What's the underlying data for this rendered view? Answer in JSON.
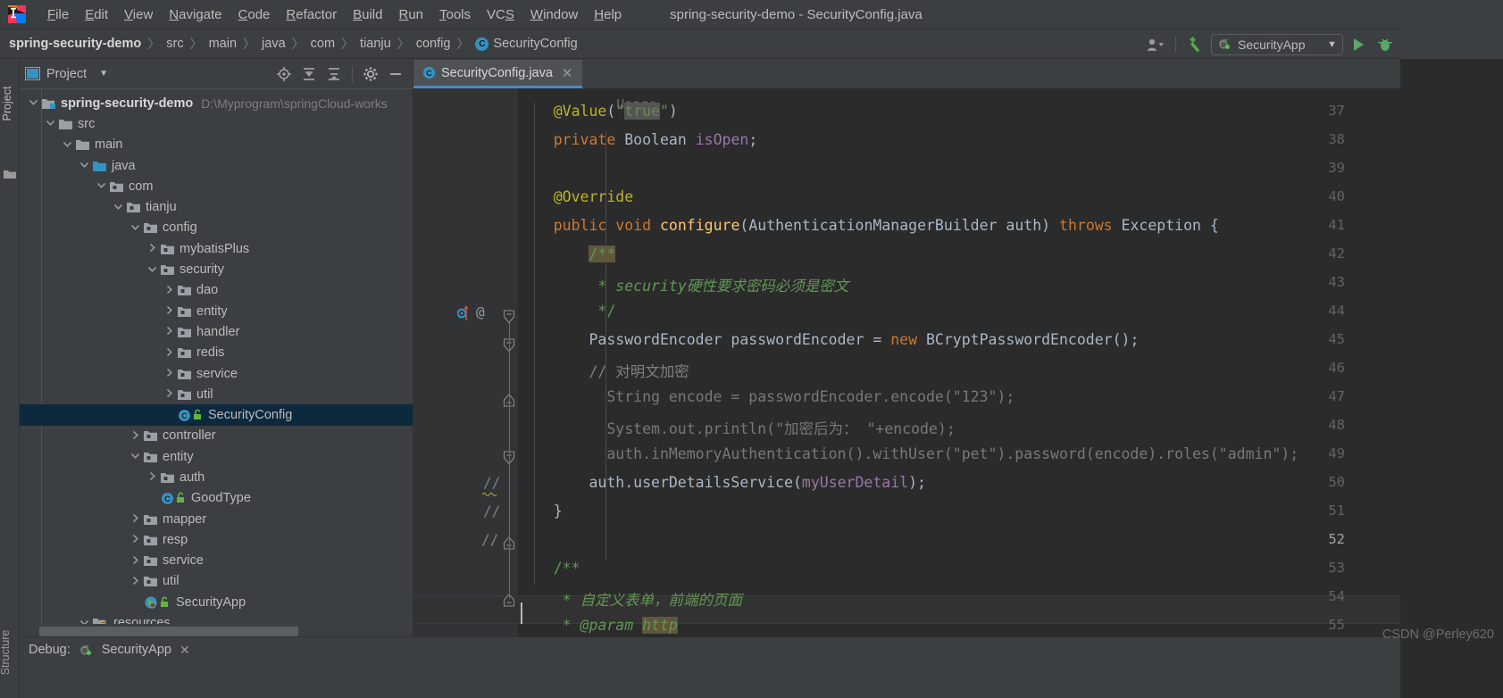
{
  "window": {
    "title": "spring-security-demo - SecurityConfig.java"
  },
  "menubar": {
    "items": [
      {
        "label": "File",
        "mnemonic": "F"
      },
      {
        "label": "Edit",
        "mnemonic": "E"
      },
      {
        "label": "View",
        "mnemonic": "V"
      },
      {
        "label": "Navigate",
        "mnemonic": "N"
      },
      {
        "label": "Code",
        "mnemonic": "C"
      },
      {
        "label": "Refactor",
        "mnemonic": "R"
      },
      {
        "label": "Build",
        "mnemonic": "B"
      },
      {
        "label": "Run",
        "mnemonic": "R"
      },
      {
        "label": "Tools",
        "mnemonic": "T"
      },
      {
        "label": "VCS",
        "mnemonic": "S"
      },
      {
        "label": "Window",
        "mnemonic": "W"
      },
      {
        "label": "Help",
        "mnemonic": "H"
      }
    ]
  },
  "breadcrumb": {
    "items": [
      "spring-security-demo",
      "src",
      "main",
      "java",
      "com",
      "tianju",
      "config",
      "SecurityConfig"
    ],
    "class_badge": "C",
    "separator": "〉"
  },
  "toolbar": {
    "run_config": "SecurityApp",
    "icons": [
      "user-icon",
      "hammer-icon",
      "run-icon",
      "debug-icon"
    ]
  },
  "left_strip": {
    "project_tab": "Project",
    "structure_tab": "Structure"
  },
  "project_panel": {
    "title": "Project",
    "header_icons": [
      "locate-icon",
      "expand-all-icon",
      "collapse-all-icon",
      "settings-icon",
      "hide-icon"
    ],
    "tree": [
      {
        "label": "spring-security-demo",
        "path": "D:\\Myprogram\\springCloud-works",
        "depth": 0,
        "state": "open",
        "icon": "module-folder",
        "bold": true
      },
      {
        "label": "src",
        "depth": 1,
        "state": "open",
        "icon": "folder"
      },
      {
        "label": "main",
        "depth": 2,
        "state": "open",
        "icon": "folder"
      },
      {
        "label": "java",
        "depth": 3,
        "state": "open",
        "icon": "source-folder"
      },
      {
        "label": "com",
        "depth": 4,
        "state": "open",
        "icon": "package"
      },
      {
        "label": "tianju",
        "depth": 5,
        "state": "open",
        "icon": "package"
      },
      {
        "label": "config",
        "depth": 6,
        "state": "open",
        "icon": "package"
      },
      {
        "label": "mybatisPlus",
        "depth": 7,
        "state": "closed",
        "icon": "package"
      },
      {
        "label": "security",
        "depth": 7,
        "state": "open",
        "icon": "package"
      },
      {
        "label": "dao",
        "depth": 8,
        "state": "closed",
        "icon": "package"
      },
      {
        "label": "entity",
        "depth": 8,
        "state": "closed",
        "icon": "package"
      },
      {
        "label": "handler",
        "depth": 8,
        "state": "closed",
        "icon": "package"
      },
      {
        "label": "redis",
        "depth": 8,
        "state": "closed",
        "icon": "package"
      },
      {
        "label": "service",
        "depth": 8,
        "state": "closed",
        "icon": "package"
      },
      {
        "label": "util",
        "depth": 8,
        "state": "closed",
        "icon": "package"
      },
      {
        "label": "SecurityConfig",
        "depth": 8,
        "state": "leaf",
        "icon": "java-class",
        "selected": true
      },
      {
        "label": "controller",
        "depth": 6,
        "state": "closed",
        "icon": "package"
      },
      {
        "label": "entity",
        "depth": 6,
        "state": "open",
        "icon": "package"
      },
      {
        "label": "auth",
        "depth": 7,
        "state": "closed",
        "icon": "package"
      },
      {
        "label": "GoodType",
        "depth": 7,
        "state": "leaf",
        "icon": "java-class"
      },
      {
        "label": "mapper",
        "depth": 6,
        "state": "closed",
        "icon": "package"
      },
      {
        "label": "resp",
        "depth": 6,
        "state": "closed",
        "icon": "package"
      },
      {
        "label": "service",
        "depth": 6,
        "state": "closed",
        "icon": "package"
      },
      {
        "label": "util",
        "depth": 6,
        "state": "closed",
        "icon": "package"
      },
      {
        "label": "SecurityApp",
        "depth": 6,
        "state": "leaf",
        "icon": "spring-class"
      },
      {
        "label": "resources",
        "depth": 3,
        "state": "open",
        "icon": "resource-folder"
      }
    ]
  },
  "editor": {
    "tab": {
      "label": "SecurityConfig.java",
      "close": "✕",
      "icon": "java-class"
    },
    "usage_hint": "Usage",
    "line_numbers": [
      "37",
      "38",
      "39",
      "40",
      "41",
      "42",
      "43",
      "44",
      "45",
      "46",
      "47",
      "48",
      "49",
      "50",
      "51",
      "52",
      "53",
      "54",
      "55"
    ],
    "current_line": "52",
    "gutter_comment_marks": [
      "//",
      "//",
      "//"
    ],
    "code": [
      {
        "n": "37",
        "segments": [
          {
            "t": "    ",
            "c": "t"
          },
          {
            "t": "@Value",
            "c": "an"
          },
          {
            "t": "(",
            "c": "t"
          },
          {
            "t": "\"",
            "c": "s"
          },
          {
            "t": "true",
            "c": "s hl-sel"
          },
          {
            "t": "\"",
            "c": "s"
          },
          {
            "t": ")",
            "c": "t"
          }
        ]
      },
      {
        "n": "38",
        "segments": [
          {
            "t": "    ",
            "c": "t"
          },
          {
            "t": "private",
            "c": "k"
          },
          {
            "t": " Boolean ",
            "c": "t"
          },
          {
            "t": "isOpen",
            "c": "f"
          },
          {
            "t": ";",
            "c": "t"
          }
        ]
      },
      {
        "n": "39",
        "segments": []
      },
      {
        "n": "40",
        "segments": [
          {
            "t": "    ",
            "c": "t"
          },
          {
            "t": "@Override",
            "c": "an"
          }
        ]
      },
      {
        "n": "41",
        "segments": [
          {
            "t": "    ",
            "c": "t"
          },
          {
            "t": "public",
            "c": "k"
          },
          {
            "t": " ",
            "c": "t"
          },
          {
            "t": "void",
            "c": "k"
          },
          {
            "t": " ",
            "c": "t"
          },
          {
            "t": "configure",
            "c": "m"
          },
          {
            "t": "(AuthenticationManagerBuilder auth) ",
            "c": "t"
          },
          {
            "t": "throws",
            "c": "k"
          },
          {
            "t": " Exception {",
            "c": "t"
          }
        ]
      },
      {
        "n": "42",
        "segments": [
          {
            "t": "        ",
            "c": "t"
          },
          {
            "t": "/**",
            "c": "jdt hl-doc"
          }
        ]
      },
      {
        "n": "43",
        "segments": [
          {
            "t": "         * ",
            "c": "jdt"
          },
          {
            "t": "security硬性要求密码必须是密文",
            "c": "jd"
          }
        ]
      },
      {
        "n": "44",
        "segments": [
          {
            "t": "         */",
            "c": "jdt"
          }
        ]
      },
      {
        "n": "45",
        "segments": [
          {
            "t": "        PasswordEncoder passwordEncoder ",
            "c": "t"
          },
          {
            "t": "=",
            "c": "t"
          },
          {
            "t": " ",
            "c": "t"
          },
          {
            "t": "new",
            "c": "k"
          },
          {
            "t": " BCryptPasswordEncoder();",
            "c": "t"
          }
        ]
      },
      {
        "n": "46",
        "segments": [
          {
            "t": "        // 对明文加密",
            "c": "c"
          }
        ]
      },
      {
        "n": "47",
        "segments": [
          {
            "t": "          String encode = passwordEncoder.encode(\"123\");",
            "c": "ci"
          }
        ]
      },
      {
        "n": "48",
        "segments": [
          {
            "t": "          System.out.println(\"加密后为： \"+encode);",
            "c": "ci"
          }
        ]
      },
      {
        "n": "49",
        "segments": [
          {
            "t": "          auth.inMemoryAuthentication().withUser(\"pet\").password(encode).roles(\"admin\");",
            "c": "ci"
          }
        ]
      },
      {
        "n": "50",
        "segments": [
          {
            "t": "        auth.userDetailsService(",
            "c": "t"
          },
          {
            "t": "myUserDetail",
            "c": "f"
          },
          {
            "t": ");",
            "c": "t"
          }
        ]
      },
      {
        "n": "51",
        "segments": [
          {
            "t": "    }",
            "c": "t"
          }
        ]
      },
      {
        "n": "52",
        "segments": []
      },
      {
        "n": "53",
        "segments": [
          {
            "t": "    /**",
            "c": "jdt"
          }
        ]
      },
      {
        "n": "54",
        "segments": [
          {
            "t": "     * ",
            "c": "jdt"
          },
          {
            "t": "自定义表单，前端的页面",
            "c": "jd"
          }
        ]
      },
      {
        "n": "55",
        "segments": [
          {
            "t": "     * ",
            "c": "jdt"
          },
          {
            "t": "@param",
            "c": "jd"
          },
          {
            "t": " ",
            "c": "jd"
          },
          {
            "t": "http",
            "c": "jd hl-doc"
          }
        ]
      }
    ]
  },
  "bottom": {
    "tool_label": "Debug:",
    "config_label": "SecurityApp",
    "close": "✕"
  },
  "watermark": "CSDN @Perley620",
  "colors": {
    "panel_bg": "#3c3f41",
    "editor_bg": "#2b2b2b",
    "gutter_bg": "#313335",
    "selection_blue": "#0d293e",
    "tab_accent": "#4a88c7",
    "keyword": "#cc7832",
    "annotation": "#bbb529",
    "string": "#6a8759",
    "comment": "#808080",
    "javadoc": "#629755",
    "text": "#a9b7c6",
    "field": "#9876aa",
    "method": "#ffc66d"
  }
}
